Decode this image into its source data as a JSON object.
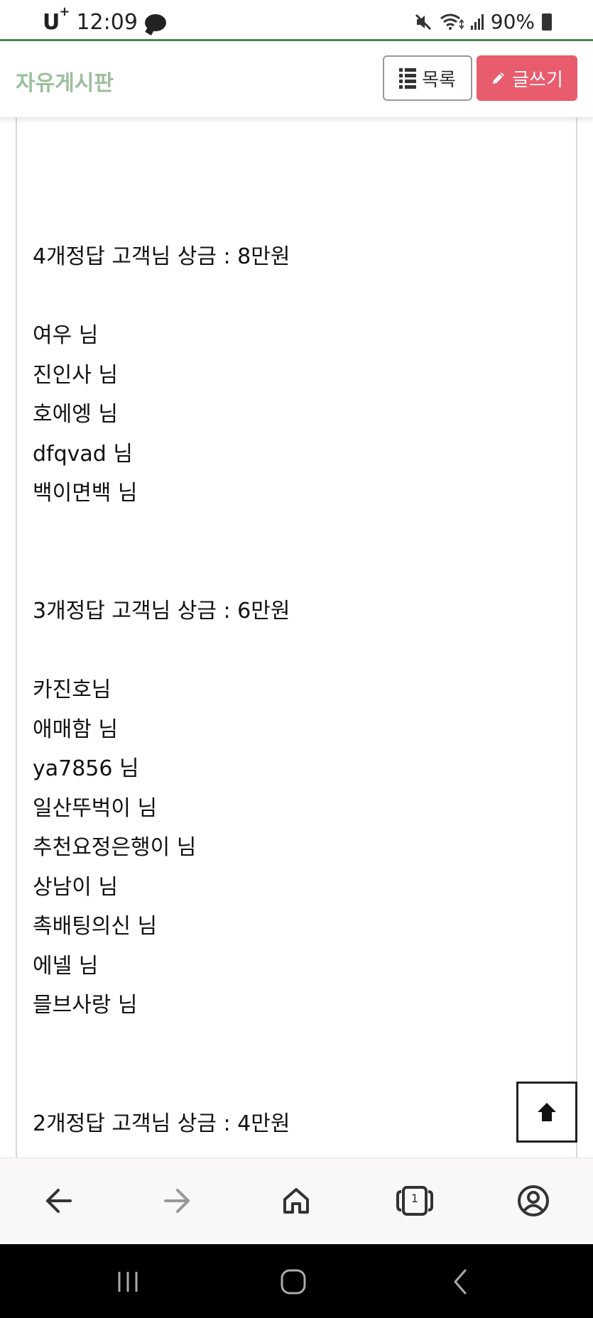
{
  "status_bar": {
    "carrier": "U",
    "carrier_sup": "+",
    "time": "12:09",
    "battery": "90%",
    "icons": [
      "mute-icon",
      "wifi-icon",
      "signal-icon",
      "battery-icon"
    ]
  },
  "header": {
    "title": "자유게시판",
    "list_button": "목록",
    "write_button": "글쓰기"
  },
  "post": {
    "lines": [
      "4개정답 고객님  상금 : 8만원",
      "여우 님",
      "진인사 님",
      "호에엥 님",
      "dfqvad 님",
      "백이면백 님",
      "3개정답 고객님  상금 : 6만원",
      "카진호님",
      "애매함 님",
      "ya7856 님",
      "일산뚜벅이 님",
      "추천요정은행이 님",
      "상남이 님",
      "촉배팅의신 님",
      "에넬 님",
      "믈브사랑 님",
      "2개정답 고객님  상금 : 4만원"
    ]
  },
  "browser_nav": {
    "tab_count": "1",
    "items": [
      "back-icon",
      "forward-icon",
      "home-icon",
      "tabs-icon",
      "account-icon"
    ]
  },
  "colors": {
    "title_green": "#9dbf9d",
    "write_red": "#e85c6e",
    "accent_line": "#4a8a4a"
  }
}
